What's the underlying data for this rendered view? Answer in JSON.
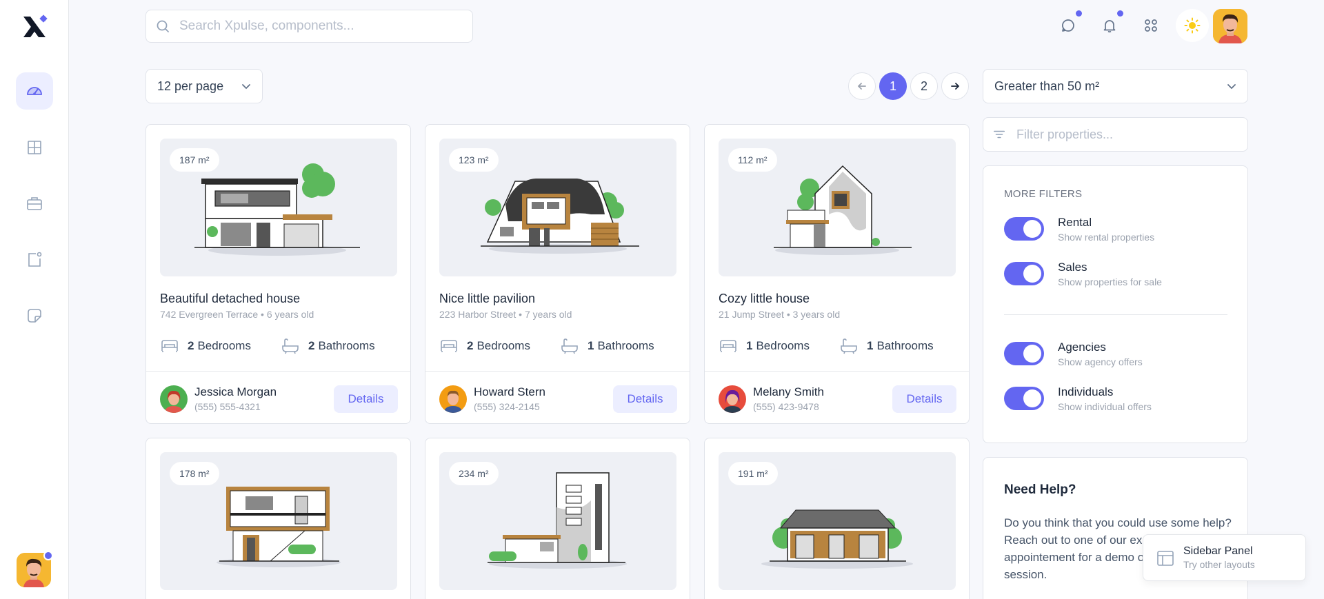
{
  "header": {
    "search_placeholder": "Search Xpulse, components..."
  },
  "toolbar": {
    "per_page": "12 per page",
    "pages": [
      "1",
      "2"
    ],
    "current_page": 1
  },
  "filters": {
    "area": "Greater than 50 m²",
    "filter_placeholder": "Filter properties...",
    "more_title": "MORE FILTERS",
    "toggles": [
      {
        "label": "Rental",
        "sub": "Show rental properties",
        "on": true
      },
      {
        "label": "Sales",
        "sub": "Show properties for sale",
        "on": true
      },
      {
        "label": "Agencies",
        "sub": "Show agency offers",
        "on": true
      },
      {
        "label": "Individuals",
        "sub": "Show individual offers",
        "on": true
      }
    ]
  },
  "help": {
    "title": "Need Help?",
    "text": "Do you think that you could use some help? Reach out to one of our experts to make an appointement for a demo or a consulting session."
  },
  "sidebar_panel": {
    "title": "Sidebar Panel",
    "sub": "Try other layouts"
  },
  "properties": [
    {
      "area": "187 m²",
      "title": "Beautiful detached house",
      "sub": "742 Evergreen Terrace • 6 years old",
      "bedrooms": "2",
      "bathrooms": "2",
      "bed_label": "Bedrooms",
      "bath_label": "Bathrooms",
      "agent": "Jessica Morgan",
      "phone": "(555) 555-4321",
      "button": "Details"
    },
    {
      "area": "123 m²",
      "title": "Nice little pavilion",
      "sub": "223 Harbor Street • 7 years old",
      "bedrooms": "2",
      "bathrooms": "1",
      "bed_label": "Bedrooms",
      "bath_label": "Bathrooms",
      "agent": "Howard Stern",
      "phone": "(555) 324-2145",
      "button": "Details"
    },
    {
      "area": "112 m²",
      "title": "Cozy little house",
      "sub": "21 Jump Street • 3 years old",
      "bedrooms": "1",
      "bathrooms": "1",
      "bed_label": "Bedrooms",
      "bath_label": "Bathrooms",
      "agent": "Melany Smith",
      "phone": "(555) 423-9478",
      "button": "Details"
    },
    {
      "area": "178 m²"
    },
    {
      "area": "234 m²"
    },
    {
      "area": "191 m²"
    }
  ],
  "colors": {
    "accent": "#6366f1",
    "accent_soft": "#eceeff",
    "tree_green": "#5cb85c",
    "wood": "#b8843f"
  }
}
